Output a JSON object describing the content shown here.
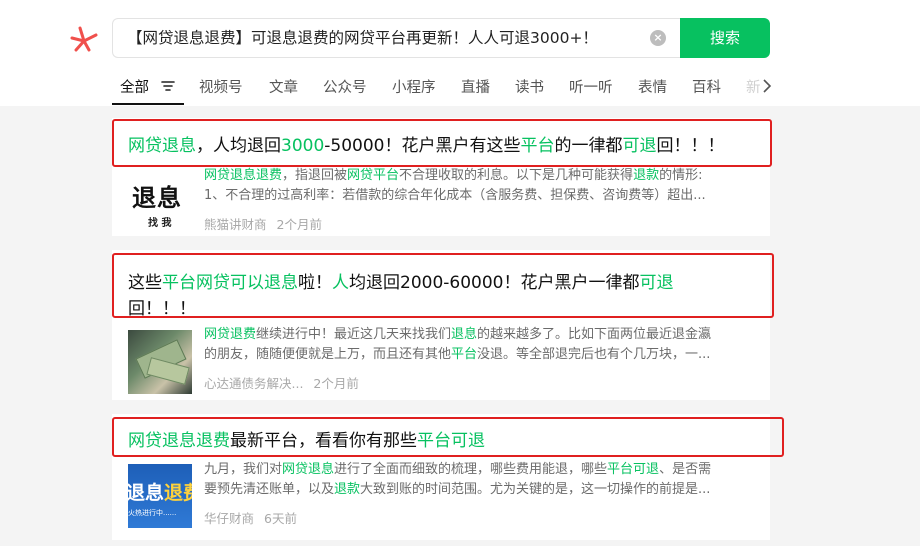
{
  "search": {
    "query": "【网贷退息退费】可退息退费的网贷平台再更新！人人可退3000+！",
    "clear_icon": "clear-icon",
    "button_label": "搜索"
  },
  "tabs": {
    "items": [
      "全部",
      "视频号",
      "文章",
      "公众号",
      "小程序",
      "直播",
      "读书",
      "听一听",
      "表情",
      "百科",
      "新"
    ],
    "active": "全部",
    "filter_icon": "filter-icon",
    "more_icon": "chevron-right-icon"
  },
  "results": [
    {
      "title": [
        {
          "t": "网贷退息",
          "hl": true
        },
        {
          "t": "，人均退回",
          "hl": false
        },
        {
          "t": "3000",
          "hl": true
        },
        {
          "t": "-50000！花户黑户有这些",
          "hl": false
        },
        {
          "t": "平台",
          "hl": true
        },
        {
          "t": "的一律都",
          "hl": false
        },
        {
          "t": "可退",
          "hl": true
        },
        {
          "t": "回！！！",
          "hl": false
        }
      ],
      "snippet_lines": [
        [
          {
            "t": "网贷退息退费",
            "hl": true
          },
          {
            "t": "，指退回被",
            "hl": false
          },
          {
            "t": "网贷平台",
            "hl": true
          },
          {
            "t": "不合理收取的利息。以下是几种可能获得",
            "hl": false
          },
          {
            "t": "退款",
            "hl": true
          },
          {
            "t": "的情形:",
            "hl": false
          }
        ],
        [
          {
            "t": "1、不合理的过高利率：若借款的综合年化成本（含服务费、担保费、咨询费等）超出...",
            "hl": false
          }
        ]
      ],
      "thumb_text": [
        "退息",
        "找 我"
      ],
      "source": "熊猫讲财商",
      "time": "2个月前"
    },
    {
      "title": [
        {
          "t": "这些",
          "hl": false
        },
        {
          "t": "平台网贷可以退息",
          "hl": true
        },
        {
          "t": "啦！",
          "hl": false
        },
        {
          "t": "人",
          "hl": true
        },
        {
          "t": "均退回2000-60000！花户黑户一律都",
          "hl": false
        },
        {
          "t": "可退",
          "hl": true
        },
        {
          "t": "回！！！",
          "hl": false
        }
      ],
      "snippet_lines": [
        [
          {
            "t": "网贷退费",
            "hl": true
          },
          {
            "t": "继续进行中！最近这几天来找我们",
            "hl": false
          },
          {
            "t": "退息",
            "hl": true
          },
          {
            "t": "的越来越多了。比如下面两位最近退金瀛",
            "hl": false
          }
        ],
        [
          {
            "t": "的朋友，随随便便就是上万，而且还有其他",
            "hl": false
          },
          {
            "t": "平台",
            "hl": true
          },
          {
            "t": "没退。等全部退完后也有个几万块，一...",
            "hl": false
          }
        ]
      ],
      "source": "心达通债务解决...",
      "time": "2个月前"
    },
    {
      "title": [
        {
          "t": "网贷退息退费",
          "hl": true
        },
        {
          "t": "最新平台，看看你有那些",
          "hl": false
        },
        {
          "t": "平台可退",
          "hl": true
        }
      ],
      "snippet_lines": [
        [
          {
            "t": "九月，我们对",
            "hl": false
          },
          {
            "t": "网贷退息",
            "hl": true
          },
          {
            "t": "进行了全面而细致的梳理，哪些费用能退，哪些",
            "hl": false
          },
          {
            "t": "平台可退",
            "hl": true
          },
          {
            "t": "、是否需",
            "hl": false
          }
        ],
        [
          {
            "t": "要预先清还账单，以及",
            "hl": false
          },
          {
            "t": "退款",
            "hl": true
          },
          {
            "t": "大致到账的时间范围。尤为关键的是，这一切操作的前提是...",
            "hl": false
          }
        ]
      ],
      "thumb_text": [
        "退息",
        "退费",
        "火热进行中......"
      ],
      "source": "华仔财商",
      "time": "6天前"
    }
  ],
  "colors": {
    "accent": "#07c160",
    "highlight_box": "#e02020"
  }
}
